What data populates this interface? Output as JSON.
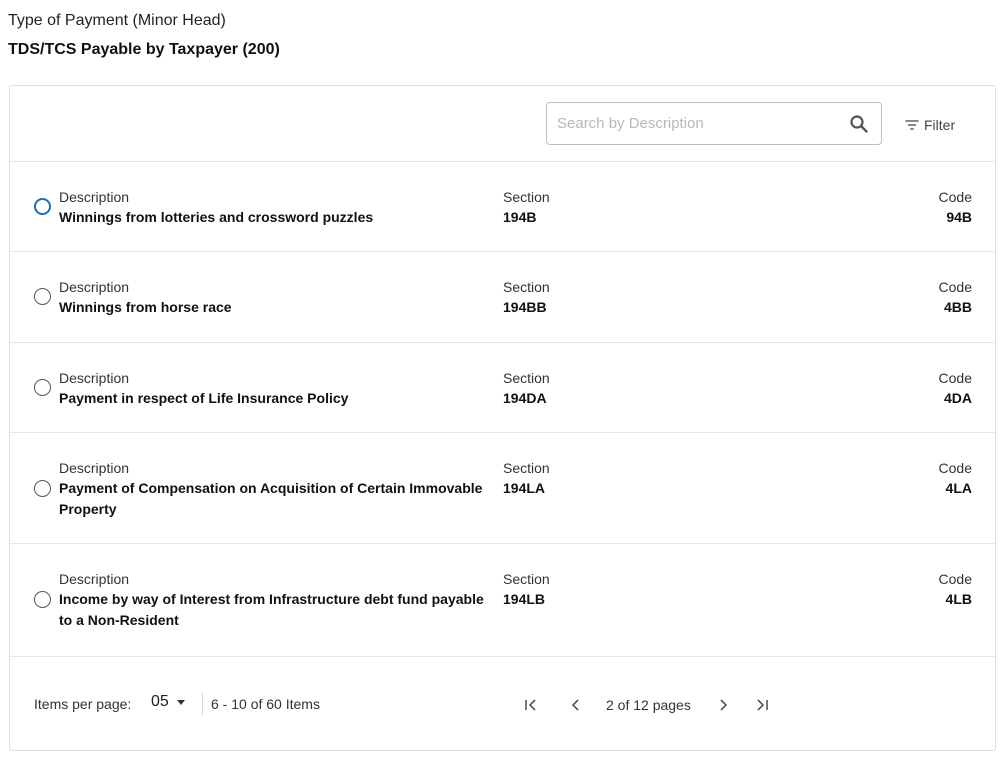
{
  "header": {
    "label": "Type of Payment (Minor Head)",
    "value": "TDS/TCS Payable by Taxpayer (200)"
  },
  "toolbar": {
    "search_placeholder": "Search by Description",
    "search_value": "",
    "filter_label": "Filter"
  },
  "columns": {
    "description": "Description",
    "section": "Section",
    "code": "Code"
  },
  "rows": [
    {
      "description": "Winnings from lotteries and crossword puzzles",
      "section": "194B",
      "code": "94B",
      "selected": false
    },
    {
      "description": "Winnings from horse race",
      "section": "194BB",
      "code": "4BB",
      "selected": false
    },
    {
      "description": "Payment in respect of Life Insurance Policy",
      "section": "194DA",
      "code": "4DA",
      "selected": false
    },
    {
      "description": "Payment of Compensation on Acquisition of Certain Immovable Property",
      "section": "194LA",
      "code": "4LA",
      "selected": false
    },
    {
      "description": "Income by way of Interest from Infrastructure debt fund payable to a Non-Resident",
      "section": "194LB",
      "code": "4LB",
      "selected": false
    }
  ],
  "pagination": {
    "items_per_page_label": "Items per page:",
    "items_per_page_value": "05",
    "range_text": "6 - 10 of 60 Items",
    "page_text": "2 of 12 pages"
  },
  "icons": {
    "search": "search-icon",
    "filter": "filter-icon",
    "caret": "caret-down-icon",
    "first": "first-page-icon",
    "prev": "chevron-left-icon",
    "next": "chevron-right-icon",
    "last": "last-page-icon"
  },
  "colors": {
    "focus_ring": "#1c6fb6",
    "border": "#dcdfe3",
    "text": "#222222"
  }
}
